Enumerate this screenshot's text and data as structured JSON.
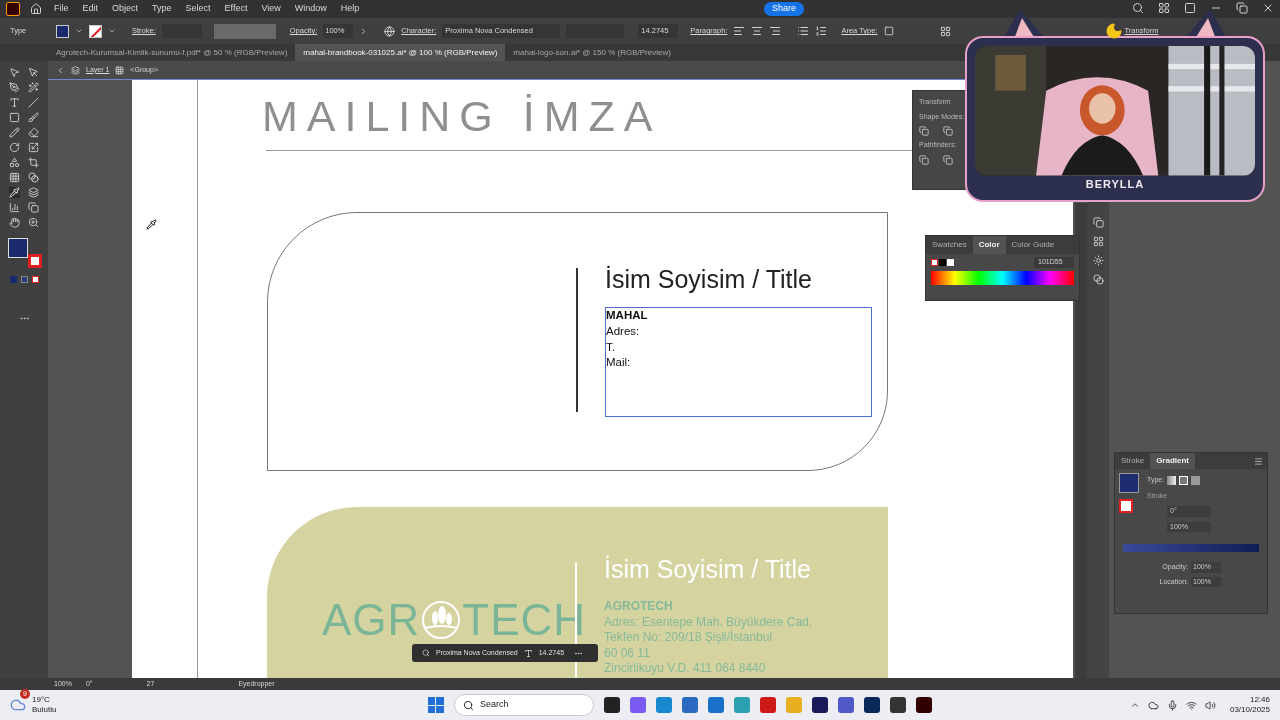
{
  "menu": [
    "File",
    "Edit",
    "Object",
    "Type",
    "Select",
    "Effect",
    "View",
    "Window",
    "Help"
  ],
  "share": "Share",
  "control_bar": {
    "mode": "Type",
    "stroke_label": "Stroke:",
    "opacity_label": "Opacity:",
    "opacity": "100%",
    "character_label": "Character:",
    "font": "Proxima Nova Condensed",
    "size": "14.2745",
    "paragraph_label": "Paragraph:",
    "area_type_label": "Area Type:",
    "transform_label": "Transform"
  },
  "tabs": [
    {
      "label": "Agrotech-Kurumsal-Kimlik-sunumu-f.pdf* @ 50 % (RGB/Preview)",
      "selected": false
    },
    {
      "label": "mahal-brandbook-031025.ai* @ 100 % (RGB/Preview)",
      "selected": true
    },
    {
      "label": "mahal-logo-son.ai* @ 150 % (RGB/Preview)",
      "selected": false
    }
  ],
  "breadcrumb": {
    "layer": "Layer 1",
    "group": "<Group>"
  },
  "artboard": {
    "heading": "MAILING İMZA",
    "cards": [
      {
        "kind": "outline",
        "title": "İsim Soyisim / Title",
        "lines": [
          {
            "text": "MAHAL",
            "bold": true
          },
          {
            "text": "Adres:",
            "bold": false
          },
          {
            "text": "T.",
            "bold": false
          },
          {
            "text": "Mail:",
            "bold": false
          }
        ]
      },
      {
        "kind": "filled",
        "logo": [
          "AGR",
          "TECH"
        ],
        "title": "İsim Soyisim / Title",
        "lines": [
          {
            "text": "AGROTECH",
            "bold": true
          },
          {
            "text": "Adres: Esentepe Mah. Büyükdere Cad.",
            "bold": false
          },
          {
            "text": "Tekfen No: 209/18 Şişli/İstanbul",
            "bold": false
          },
          {
            "text": "60 06 11",
            "bold": false
          },
          {
            "text": "Zincirlikuyu V.D. 411 064 8440",
            "bold": false
          }
        ]
      }
    ]
  },
  "transform_panel": {
    "title": "Transform",
    "shape_modes": "Shape Modes:",
    "pathfinders": "Pathfinders:"
  },
  "color_panel": {
    "tabs": [
      {
        "label": "Swatches",
        "selected": false
      },
      {
        "label": "Color",
        "selected": true
      },
      {
        "label": "Color Guide",
        "selected": false
      }
    ],
    "hex": "101D55"
  },
  "gradient_panel": {
    "tabs": [
      {
        "label": "Stroke",
        "selected": false
      },
      {
        "label": "Gradient",
        "selected": true
      }
    ],
    "type_label": "Type:",
    "stroke_label": "Stroke",
    "angle": "0°",
    "aspect": "100%",
    "opacity_label": "Opacity:",
    "opacity": "100%",
    "location_label": "Location:",
    "location": "100%"
  },
  "text_toolbar": {
    "font": "Proxima Nova Condensed",
    "size": "14.2745"
  },
  "webcam": {
    "kind": "picture",
    "name": "BERYLLA"
  },
  "status_bar": {
    "zoom": "100%",
    "rotation": "0°",
    "artboard": "27",
    "tool": "Eyedropper"
  },
  "taskbar": {
    "badge": "9",
    "temperature": "19°C",
    "weather": "Bulutlu",
    "search": "Search",
    "time": "12:46",
    "date": "03/10/2025"
  }
}
